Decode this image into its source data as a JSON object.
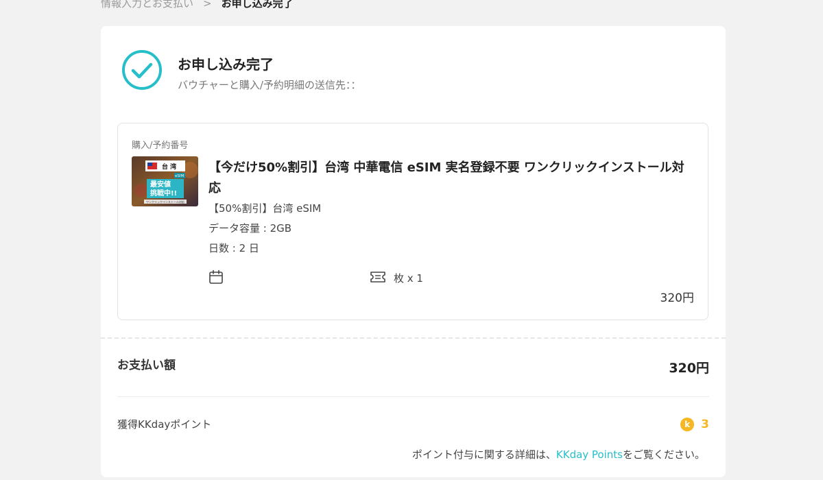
{
  "breadcrumb": {
    "prev": "情報入力とお支払い",
    "separator": ">",
    "current": "お申し込み完了"
  },
  "success": {
    "title": "お申し込み完了",
    "subtitle": "バウチャーと購入/予約明細の送信先：：",
    "icon": "check-circle-icon",
    "accent_color": "#26bec9"
  },
  "order": {
    "label": "購入/予約番号",
    "thumbnail": {
      "flag_text": "台 湾",
      "badge": "eSIM",
      "line1": "最安値",
      "line2": "挑戦中!!",
      "footer": "ワンクリックインストール対応"
    },
    "title": "【今だけ50%割引】台湾 中華電信 eSIM 実名登録不要 ワンクリックインストール対応",
    "package": "【50%割引】台湾 eSIM",
    "data": "データ容量 : 2GB",
    "days": "日数 : 2 日",
    "ticket": "枚 x 1",
    "price": "320円"
  },
  "payment": {
    "label": "お支払い額",
    "amount": "320円"
  },
  "points": {
    "label": "獲得KKdayポイント",
    "coin": "k",
    "value": "3",
    "note_before": "ポイント付与に関する詳細は、",
    "note_link": "KKday Points",
    "note_after": "をご覧ください。",
    "coin_color": "#f5b824"
  }
}
